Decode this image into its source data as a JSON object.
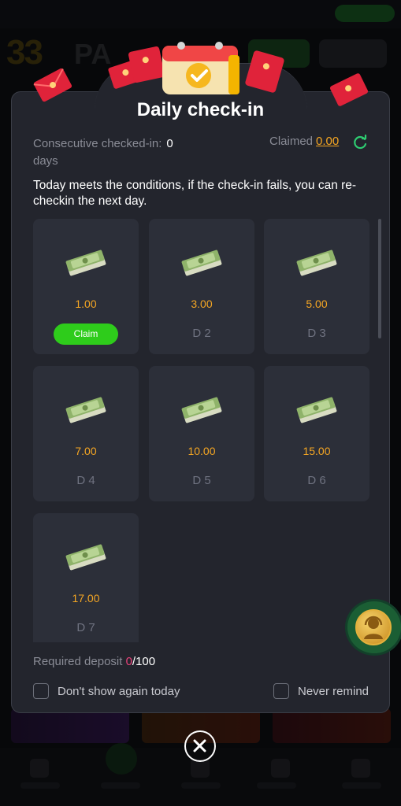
{
  "dialog": {
    "title": "Daily check-in",
    "consecutive_label": "Consecutive checked-in:",
    "consecutive_value": "0",
    "consecutive_unit": "days",
    "claimed_label": "Claimed",
    "claimed_value": "0.00",
    "notice": "Today meets the conditions, if the check-in fails, you can re-checkin the next day.",
    "days": [
      {
        "amount": "1.00",
        "claim_label": "Claim",
        "day": ""
      },
      {
        "amount": "3.00",
        "day": "D 2"
      },
      {
        "amount": "5.00",
        "day": "D 3"
      },
      {
        "amount": "7.00",
        "day": "D 4"
      },
      {
        "amount": "10.00",
        "day": "D 5"
      },
      {
        "amount": "15.00",
        "day": "D 6"
      },
      {
        "amount": "17.00",
        "day": "D 7"
      }
    ],
    "deposit_label": "Required deposit ",
    "deposit_current": "0",
    "deposit_total": "/100",
    "dont_show_label": "Don't show again today",
    "never_remind_label": "Never remind"
  },
  "background": {
    "logo_digits": "33",
    "logo_text": "PA"
  },
  "colors": {
    "accent": "#f5a623",
    "claim_green": "#2ecc1b",
    "deposit_current": "#e8427a",
    "card_bg": "#2c2f39",
    "dialog_bg": "#23252d"
  },
  "icons": {
    "refresh": "refresh-icon",
    "money": "money-stack-icon",
    "calendar": "calendar-check-icon",
    "close": "close-icon",
    "support": "customer-support-icon",
    "red_envelope": "red-envelope-icon"
  }
}
